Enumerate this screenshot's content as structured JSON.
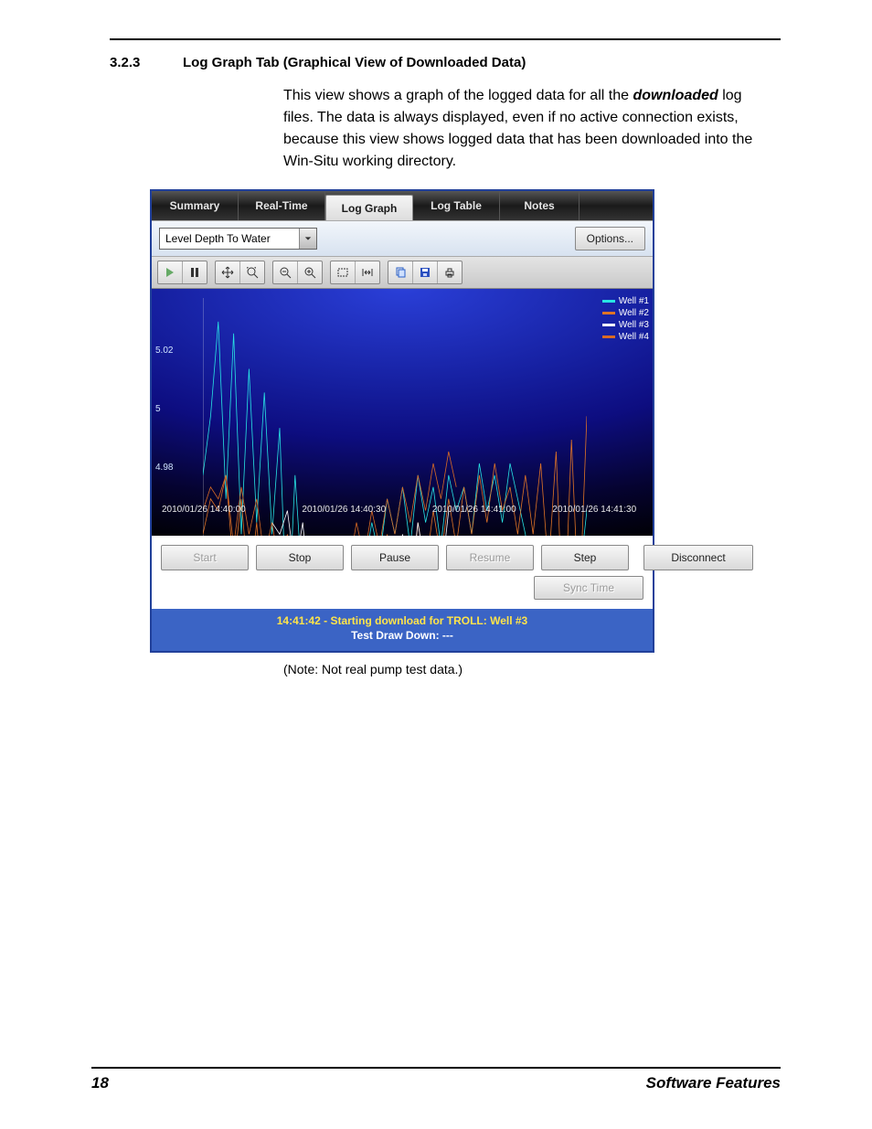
{
  "section": {
    "number": "3.2.3",
    "title": "Log Graph Tab (Graphical View of Downloaded Data)"
  },
  "body": {
    "p1a": "This view shows a graph of the logged data for all the ",
    "p1b": "downloaded",
    "p1c": " log files. The data is always displayed, even if no active connection exists, because this view shows logged data that has been downloaded into the Win-Situ working directory."
  },
  "tabs": {
    "summary": "Summary",
    "realtime": "Real-Time",
    "loggraph": "Log Graph",
    "logtable": "Log Table",
    "notes": "Notes"
  },
  "dropdown": {
    "selected": "Level Depth To Water",
    "options_btn": "Options..."
  },
  "buttons": {
    "start": "Start",
    "stop": "Stop",
    "pause": "Pause",
    "resume": "Resume",
    "step": "Step",
    "disconnect": "Disconnect",
    "synctime": "Sync Time"
  },
  "status": {
    "line1": "14:41:42 - Starting download for TROLL: Well #3",
    "line2": "Test Draw Down: ---"
  },
  "note": "(Note: Not real pump test data.)",
  "footer": {
    "page": "18",
    "chapter": "Software Features"
  },
  "chart_data": {
    "type": "line",
    "title": "",
    "xlabel": "",
    "ylabel": "",
    "ylim": [
      4.975,
      5.04
    ],
    "y_ticks": [
      5.02,
      5.0,
      4.98
    ],
    "x_ticks": [
      "2010/01/26 14:40:00",
      "2010/01/26 14:40:30",
      "2010/01/26 14:41:00",
      "2010/01/26 14:41:30"
    ],
    "x": [
      0,
      2,
      4,
      6,
      8,
      10,
      12,
      14,
      16,
      18,
      20,
      22,
      24,
      26,
      28,
      30,
      32,
      34,
      36,
      38,
      40,
      42,
      44,
      46,
      48,
      50,
      52,
      54,
      56,
      58,
      60,
      62,
      64,
      66,
      68,
      70,
      72,
      74,
      76,
      78,
      80,
      82,
      84,
      86,
      88,
      90,
      92,
      94,
      96,
      98,
      100
    ],
    "series": [
      {
        "name": "Well #1",
        "color": "#28e4e4",
        "values": [
          5.01,
          5.02,
          5.036,
          5.006,
          5.034,
          5.0,
          5.028,
          5.002,
          5.024,
          5.0,
          5.018,
          4.982,
          5.01,
          4.99,
          4.996,
          4.986,
          4.992,
          4.984,
          4.994,
          4.988,
          4.998,
          4.994,
          5.002,
          4.996,
          5.006,
          5.0,
          5.008,
          4.998,
          5.01,
          5.002,
          5.008,
          4.998,
          5.01,
          5.004,
          5.008,
          5.0,
          5.012,
          5.004,
          5.01,
          5.002,
          5.012,
          5.006,
          5.0,
          4.99,
          4.992,
          4.984,
          4.98,
          4.978,
          4.986,
          4.992,
          5.004
        ]
      },
      {
        "name": "Well #2",
        "color": "#e07426",
        "values": [
          5.0,
          5.006,
          5.004,
          5.01,
          4.994,
          5.006,
          4.99,
          5.002,
          4.986,
          4.998,
          4.982,
          4.996,
          4.98,
          4.99,
          4.984,
          4.992,
          4.98,
          4.984,
          4.986,
          4.98,
          4.99,
          4.982,
          4.996,
          4.986,
          5.0,
          4.99,
          4.998,
          4.988,
          5.002,
          4.994,
          5.004,
          4.996,
          5.006,
          4.998,
          5.008,
          5.0,
          5.01,
          5.002,
          5.012,
          5.004,
          5.008,
          5.0,
          5.01,
          5.0,
          5.012,
          4.994,
          5.014,
          4.982,
          5.016,
          4.986,
          5.02
        ]
      },
      {
        "name": "Well #3",
        "color": "#ffffff",
        "values": [
          null,
          null,
          null,
          null,
          null,
          null,
          null,
          null,
          null,
          5.002,
          5.0,
          5.004,
          4.994,
          5.002,
          4.988,
          4.998,
          4.984,
          4.992,
          4.98,
          4.986,
          4.982,
          4.98,
          4.988,
          4.982,
          4.996,
          4.988,
          5.0,
          4.99,
          5.002,
          4.994,
          4.998,
          4.992,
          5.004,
          null,
          null,
          null,
          null,
          null,
          null,
          null,
          null,
          null,
          null,
          null,
          null,
          null,
          null,
          null,
          null,
          null,
          null
        ]
      },
      {
        "name": "Well #4",
        "color": "#d96a24",
        "values": [
          5.004,
          5.008,
          5.006,
          5.01,
          4.998,
          5.008,
          5.0,
          5.006,
          4.996,
          5.002,
          4.994,
          5.0,
          4.992,
          4.998,
          4.99,
          4.996,
          4.992,
          4.99,
          4.998,
          4.994,
          5.002,
          4.996,
          5.004,
          4.998,
          5.006,
          5.0,
          5.008,
          5.002,
          5.01,
          5.004,
          5.012,
          5.006,
          5.014,
          5.008,
          null,
          null,
          null,
          null,
          null,
          null,
          null,
          null,
          null,
          null,
          null,
          null,
          null,
          null,
          null,
          null,
          null
        ]
      }
    ]
  }
}
